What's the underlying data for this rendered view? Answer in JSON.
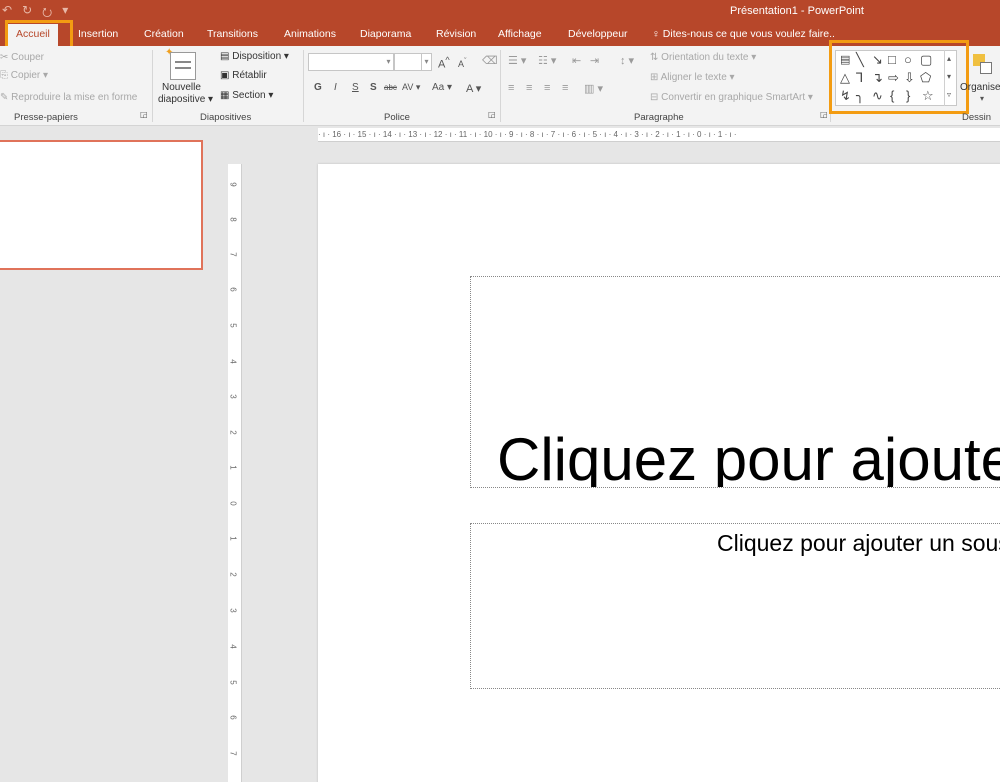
{
  "window": {
    "title": "Présentation1 - PowerPoint"
  },
  "qat": {
    "undo": "↶",
    "redo": "↻",
    "start": "⭮",
    "more": "▾"
  },
  "tabs": [
    "Accueil",
    "Insertion",
    "Création",
    "Transitions",
    "Animations",
    "Diaporama",
    "Révision",
    "Affichage",
    "Développeur"
  ],
  "tellme": "Dites-nous ce que vous voulez faire..",
  "ribbon": {
    "clipboard": {
      "cut": "Couper",
      "copy": "Copier",
      "format_painter": "Reproduire la mise en forme",
      "label": "Presse-papiers"
    },
    "slides": {
      "new_slide_line1": "Nouvelle",
      "new_slide_line2": "diapositive",
      "layout": "Disposition",
      "reset": "Rétablir",
      "section": "Section",
      "label": "Diapositives"
    },
    "font": {
      "name": "",
      "size": "",
      "bold": "G",
      "italic": "I",
      "underline": "S",
      "shadow": "S",
      "strike": "abc",
      "spacing": "AV",
      "case": "Aa",
      "color": "A",
      "grow": "A",
      "shrink": "A",
      "label": "Police"
    },
    "paragraph": {
      "text_direction": "Orientation du texte",
      "align_text": "Aligner le texte",
      "smartart": "Convertir en graphique SmartArt",
      "label": "Paragraphe"
    },
    "drawing": {
      "arrange": "Organiser",
      "label": "Dessin"
    }
  },
  "ruler": {
    "horizontal": "· ı · 16 · ı · 15 · ı · 14 · ı · 13 · ı · 12 · ı · 11 · ı · 10 · ı · 9 · ı · 8 · ı · 7 · ı · 6 · ı · 5 · ı · 4 · ı · 3 · ı · 2 · ı · 1 · ı · 0 · ı · 1 · ı ·",
    "vertical": [
      "9",
      "8",
      "7",
      "6",
      "5",
      "4",
      "3",
      "2",
      "1",
      "0",
      "1",
      "2",
      "3",
      "4",
      "5",
      "6",
      "7"
    ]
  },
  "slide": {
    "title_placeholder": "Cliquez pour ajouter un titre",
    "subtitle_placeholder": "Cliquez pour ajouter un sous-titre"
  },
  "colors": {
    "accent": "#b7472a",
    "highlight": "#f39c12",
    "thumb_border": "#e0735a"
  }
}
